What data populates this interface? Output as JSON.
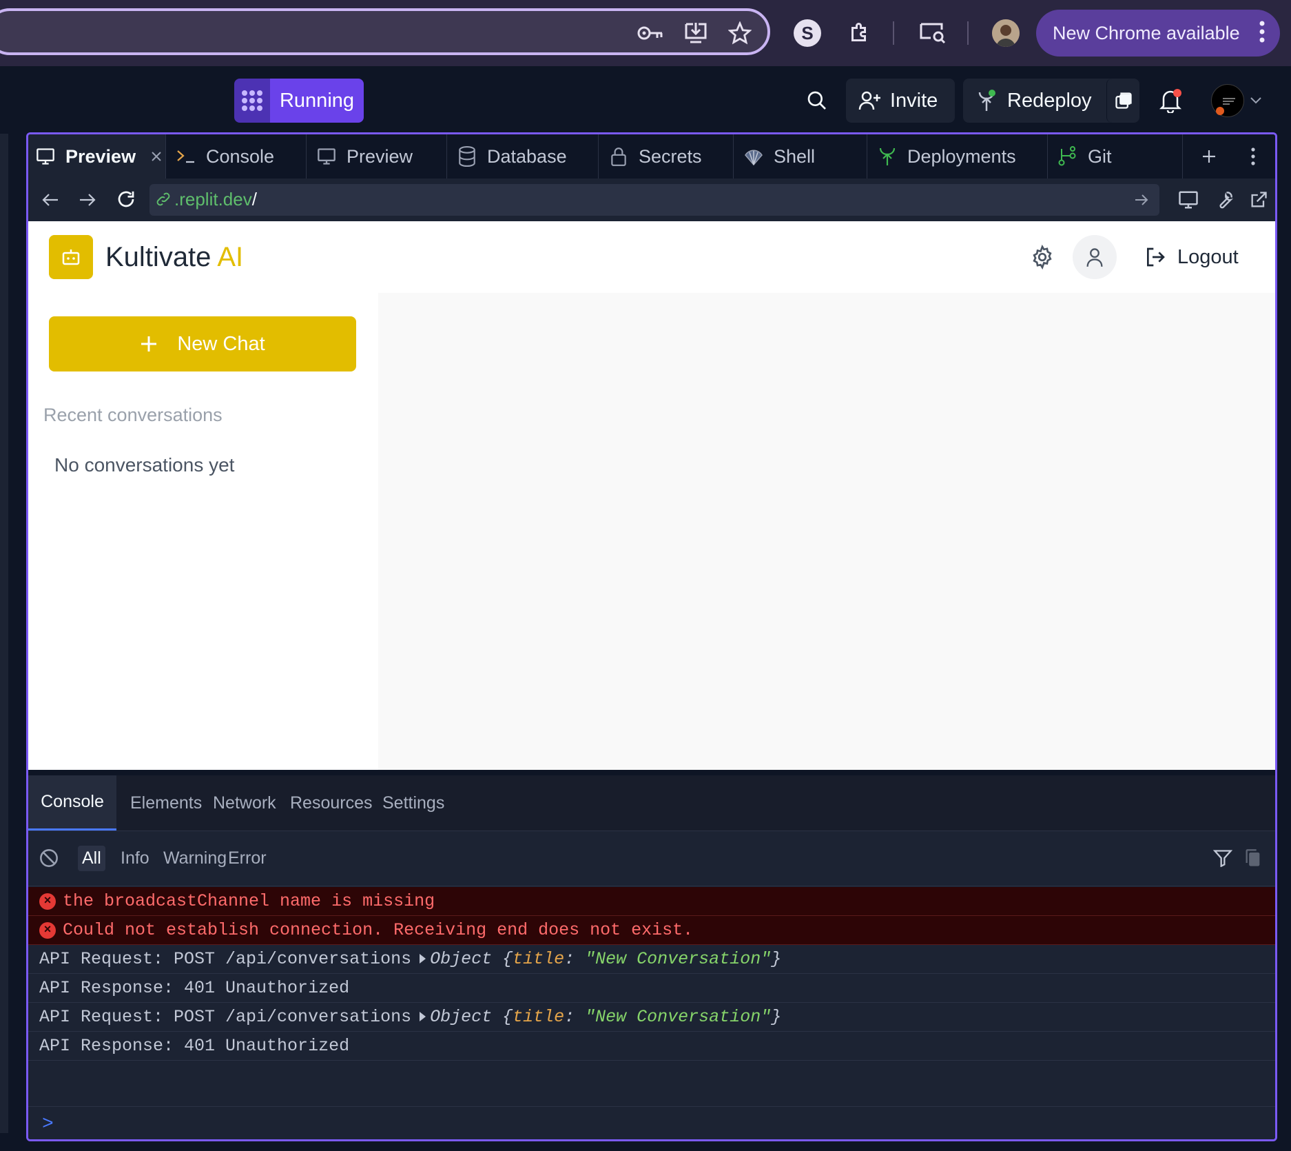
{
  "browser": {
    "new_chrome_label": "New Chrome available",
    "icons": [
      "key-icon",
      "install-app-icon",
      "star-icon",
      "s-extension-icon",
      "puzzle-extension-icon",
      "screen-search-icon",
      "profile-avatar"
    ]
  },
  "replit_header": {
    "run_status": "Running",
    "invite_label": "Invite",
    "redeploy_label": "Redeploy"
  },
  "tabs": [
    {
      "label": "Preview",
      "icon": "monitor-icon",
      "active": true
    },
    {
      "label": "Console",
      "icon": "terminal-icon"
    },
    {
      "label": "Preview",
      "icon": "monitor-icon"
    },
    {
      "label": "Database",
      "icon": "database-icon"
    },
    {
      "label": "Secrets",
      "icon": "lock-icon"
    },
    {
      "label": "Shell",
      "icon": "shell-icon"
    },
    {
      "label": "Deployments",
      "icon": "deploy-icon"
    },
    {
      "label": "Git",
      "icon": "git-icon"
    }
  ],
  "url_bar": {
    "url_domain": ".replit.dev",
    "url_path": "/"
  },
  "app": {
    "title_main": "Kultivate",
    "title_accent": "AI",
    "logout_label": "Logout",
    "new_chat_label": "New Chat",
    "recent_label": "Recent conversations",
    "empty_label": "No conversations yet",
    "accent_color": "#e2bd00"
  },
  "devtools": {
    "tabs": [
      "Console",
      "Elements",
      "Network",
      "Resources",
      "Settings"
    ],
    "filters": [
      "All",
      "Info",
      "Warning",
      "Error"
    ],
    "logs": [
      {
        "level": "error",
        "text": "the broadcastChannel name is missing"
      },
      {
        "level": "error",
        "text": "Could not establish connection. Receiving end does not exist."
      },
      {
        "level": "info",
        "text": "API Request: POST /api/conversations",
        "obj_prefix": "Object {",
        "obj_key": "title",
        "obj_value": "\"New Conversation\"",
        "obj_suffix": "}"
      },
      {
        "level": "info",
        "text": "API Response: 401 Unauthorized"
      },
      {
        "level": "info",
        "text": "API Request: POST /api/conversations",
        "obj_prefix": "Object {",
        "obj_key": "title",
        "obj_value": "\"New Conversation\"",
        "obj_suffix": "}"
      },
      {
        "level": "info",
        "text": "API Response: 401 Unauthorized"
      }
    ],
    "prompt_symbol": ">"
  }
}
